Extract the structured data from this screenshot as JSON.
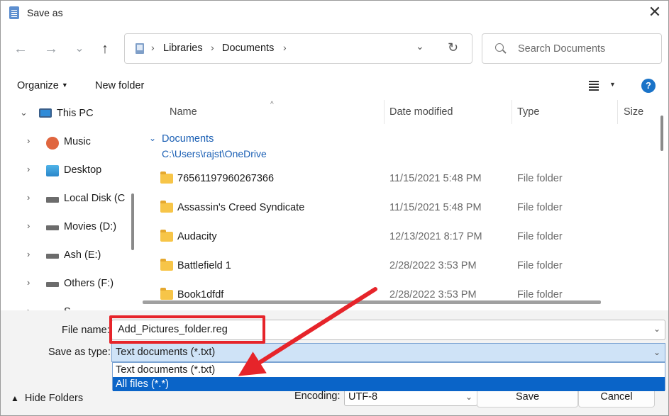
{
  "window": {
    "title": "Save as",
    "close_glyph": "✕"
  },
  "nav": {
    "back_glyph": "←",
    "forward_glyph": "→",
    "recent_glyph": "⌄",
    "up_glyph": "↑",
    "breadcrumbs": [
      "Libraries",
      "Documents"
    ],
    "search_placeholder": "Search Documents"
  },
  "commands": {
    "organize": "Organize",
    "new_folder": "New folder",
    "help": "?"
  },
  "tree": [
    {
      "label": "This PC",
      "icon": "monitor-icon",
      "expanded": true
    },
    {
      "label": "Music",
      "icon": "music-icon"
    },
    {
      "label": "Desktop",
      "icon": "desktop-icon"
    },
    {
      "label": "Local Disk (C",
      "icon": "drive-icon"
    },
    {
      "label": "Movies (D:)",
      "icon": "drive-icon"
    },
    {
      "label": "Ash (E:)",
      "icon": "drive-icon"
    },
    {
      "label": "Others (F:)",
      "icon": "drive-icon"
    },
    {
      "label": "S",
      "icon": "drive-icon"
    }
  ],
  "columns": {
    "name": "Name",
    "date": "Date modified",
    "type": "Type",
    "size": "Size"
  },
  "group": {
    "title": "Documents",
    "path": "C:\\Users\\rajst\\OneDrive"
  },
  "files": [
    {
      "name": "76561197960267366",
      "date": "11/15/2021 5:48 PM",
      "type": "File folder"
    },
    {
      "name": "Assassin's Creed Syndicate",
      "date": "11/15/2021 5:48 PM",
      "type": "File folder"
    },
    {
      "name": "Audacity",
      "date": "12/13/2021 8:17 PM",
      "type": "File folder"
    },
    {
      "name": "Battlefield 1",
      "date": "2/28/2022 3:53 PM",
      "type": "File folder"
    },
    {
      "name": "Book1dfdf",
      "date": "2/28/2022 3:53 PM",
      "type": "File folder"
    }
  ],
  "bottom": {
    "file_name_label": "File name:",
    "file_name_value": "Add_Pictures_folder.reg",
    "save_type_label": "Save as type:",
    "save_type_value": "Text documents (*.txt)",
    "type_options": [
      "Text documents (*.txt)",
      "All files  (*.*)"
    ],
    "selected_option_index": 1,
    "hide_folders": "Hide Folders",
    "encoding_label": "Encoding:",
    "encoding_value": "UTF-8",
    "save_button": "Save",
    "cancel_button": "Cancel"
  },
  "colors": {
    "accent": "#0a64c8",
    "annotation": "#e6242a",
    "link": "#1a5fb4"
  }
}
